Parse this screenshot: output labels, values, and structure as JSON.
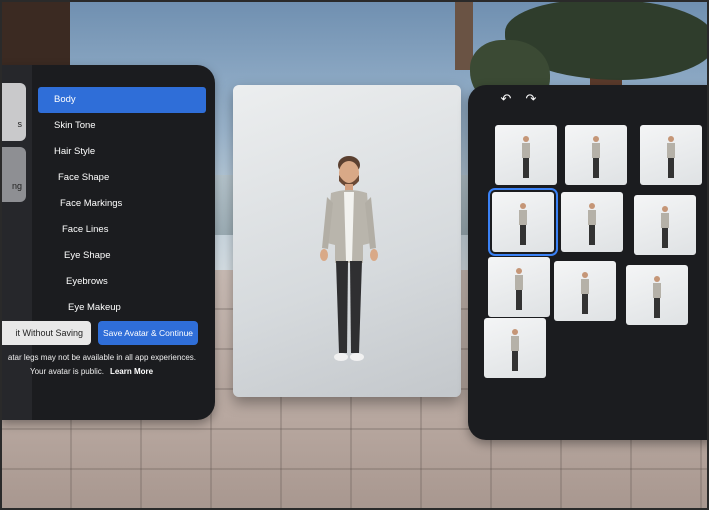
{
  "menu": {
    "items": [
      "Body",
      "Skin Tone",
      "Hair Style",
      "Face Shape",
      "Face Markings",
      "Face Lines",
      "Eye Shape",
      "Eyebrows",
      "Eye Makeup"
    ],
    "active": "Body"
  },
  "stub": {
    "label_b1": "s",
    "label_b2": "ng"
  },
  "actions": {
    "exit_label": "it Without Saving",
    "save_label": "Save Avatar & Continue"
  },
  "notes": {
    "legs": "atar legs may not be available in all app experiences.",
    "public": "Your avatar is public.",
    "learn_more": "Learn More"
  },
  "toolbar": {
    "undo_icon": "undo-icon",
    "redo_icon": "redo-icon"
  },
  "grid": {
    "thumbnail_count": 10,
    "selected_index": 3
  },
  "colors": {
    "accent": "#2f6ed8",
    "panel": "#1b1c1f",
    "selection": "#3b82f6"
  }
}
